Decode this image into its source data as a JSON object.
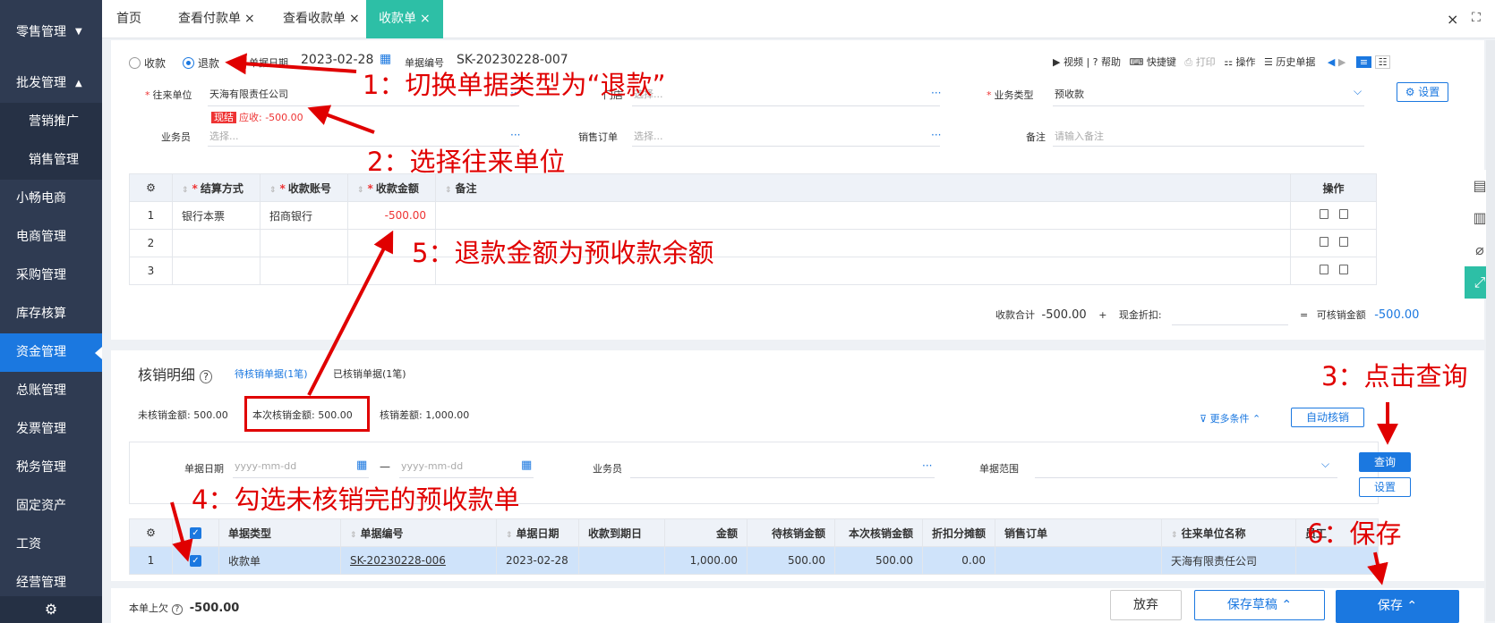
{
  "sidebar": {
    "items": [
      {
        "label": "零售管理",
        "arrow": "▼"
      },
      {
        "label": "批发管理",
        "arrow": "▲"
      },
      {
        "label": "营销推广"
      },
      {
        "label": "销售管理"
      },
      {
        "label": "小畅电商"
      },
      {
        "label": "电商管理"
      },
      {
        "label": "采购管理"
      },
      {
        "label": "库存核算"
      },
      {
        "label": "资金管理"
      },
      {
        "label": "总账管理"
      },
      {
        "label": "发票管理"
      },
      {
        "label": "税务管理"
      },
      {
        "label": "固定资产"
      },
      {
        "label": "工资"
      },
      {
        "label": "经营管理"
      }
    ],
    "gear": "⚙"
  },
  "tabs": [
    {
      "label": "首页",
      "x": ""
    },
    {
      "label": "查看付款单",
      "x": "×"
    },
    {
      "label": "查看收款单",
      "x": "×"
    },
    {
      "label": "收款单",
      "x": "×"
    }
  ],
  "window": {
    "close": "×",
    "expand": "⛶"
  },
  "header": {
    "radio_receive": "收款",
    "radio_refund": "退款",
    "date_label": "单据日期",
    "date_value": "2023-02-28",
    "no_label": "单据编号",
    "no_value": "SK-20230228-007",
    "tools": [
      "视频",
      "帮助",
      "快捷键",
      "打印",
      "操作",
      "历史单据"
    ]
  },
  "form": {
    "partner_label": "往来单位",
    "partner_value": "天海有限责任公司",
    "settle_tag": "现结",
    "receivable": "应收: -500.00",
    "store_label": "门店",
    "store_ph": "选择...",
    "biztype_label": "业务类型",
    "biztype_value": "预收款",
    "settings_btn": "设置",
    "clerk_label": "业务员",
    "clerk_ph": "选择...",
    "order_label": "销售订单",
    "order_ph": "选择...",
    "remark_label": "备注",
    "remark_ph": "请输入备注",
    "dots": "···"
  },
  "pay_table": {
    "headers": [
      "结算方式",
      "收款账号",
      "收款金额",
      "备注",
      "操作"
    ],
    "rows": [
      {
        "no": "1",
        "method": "银行本票",
        "account": "招商银行",
        "amount": "-500.00"
      },
      {
        "no": "2",
        "method": "",
        "account": "",
        "amount": ""
      },
      {
        "no": "3",
        "method": "",
        "account": "",
        "amount": ""
      }
    ]
  },
  "totals": {
    "sum_label": "收款合计",
    "sum_value": "-500.00",
    "plus": "+",
    "discount_label": "现金折扣:",
    "eq": "=",
    "avail_label": "可核销金额",
    "avail_value": "-500.00"
  },
  "writeoff": {
    "title": "核销明细",
    "help": "?",
    "tab_pending": "待核销单据(1笔)",
    "tab_done": "已核销单据(1笔)",
    "unverified": "未核销金额: 500.00",
    "current": "本次核销金额: 500.00",
    "diff": "核销差额: 1,000.00",
    "more": "更多条件",
    "auto_btn": "自动核销",
    "filter_date_label": "单据日期",
    "filter_date_ph": "yyyy-mm-dd",
    "dash": "—",
    "filter_clerk_label": "业务员",
    "filter_range_label": "单据范围",
    "query_btn": "查询",
    "set_btn": "设置"
  },
  "wo_table": {
    "headers": [
      "单据类型",
      "单据编号",
      "单据日期",
      "收款到期日",
      "金额",
      "待核销金额",
      "本次核销金额",
      "折扣分摊额",
      "销售订单",
      "往来单位名称",
      "员工"
    ],
    "row": {
      "no": "1",
      "type": "收款单",
      "code": "SK-20230228-006",
      "date": "2023-02-28",
      "due": "",
      "amount": "1,000.00",
      "pending": "500.00",
      "current": "500.00",
      "discount": "0.00",
      "order": "",
      "partner": "天海有限责任公司"
    }
  },
  "footer": {
    "prev_label": "本单上欠",
    "prev_value": "-500.00",
    "discard": "放弃",
    "draft": "保存草稿",
    "save": "保存"
  },
  "annotations": {
    "a1": "1：切换单据类型为“退款”",
    "a2": "2：选择往来单位",
    "a3": "3：点击查询",
    "a4": "4：勾选未核销完的预收款单",
    "a5": "5：退款金额为预收款余额",
    "a6": "6：保存"
  },
  "colors": {
    "accent": "#1b78e0",
    "tab_active": "#2dbfa6",
    "annotation": "#e00000",
    "sidebar": "#2f3b52"
  }
}
